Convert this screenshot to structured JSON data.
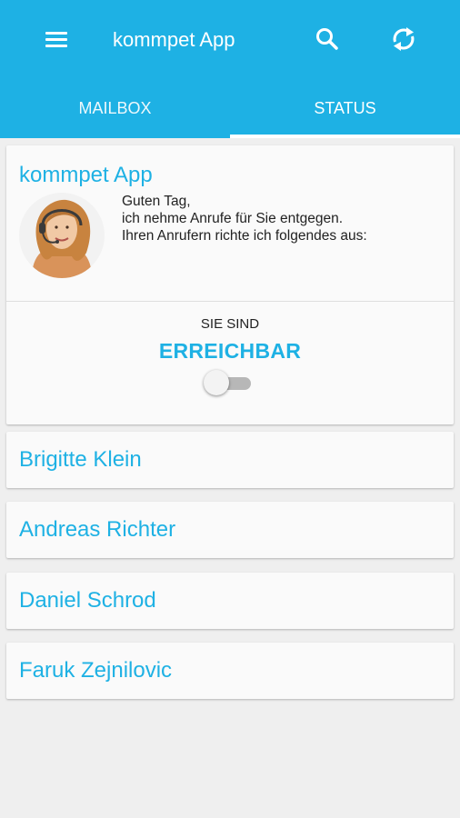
{
  "toolbar": {
    "title": "kommpet App",
    "menu_icon": "menu-icon",
    "search_icon": "search-icon",
    "refresh_icon": "refresh-icon"
  },
  "tabs": [
    {
      "label": "MAILBOX",
      "selected": false
    },
    {
      "label": "STATUS",
      "selected": true
    }
  ],
  "profile": {
    "title": "kommpet App",
    "greeting_lines": [
      "Guten Tag,",
      "ich nehme Anrufe für Sie entgegen.",
      "Ihren Anrufern richte ich folgendes aus:"
    ],
    "status_label": "SIE SIND",
    "status_value": "ERREICHBAR",
    "toggle_on": false
  },
  "contacts": [
    {
      "name": "Brigitte Klein"
    },
    {
      "name": "Andreas Richter"
    },
    {
      "name": "Daniel Schrod"
    },
    {
      "name": "Faruk Zejnilovic"
    }
  ],
  "colors": {
    "accent": "#1eb1e4",
    "background": "#efefef",
    "card": "#fafafa"
  }
}
